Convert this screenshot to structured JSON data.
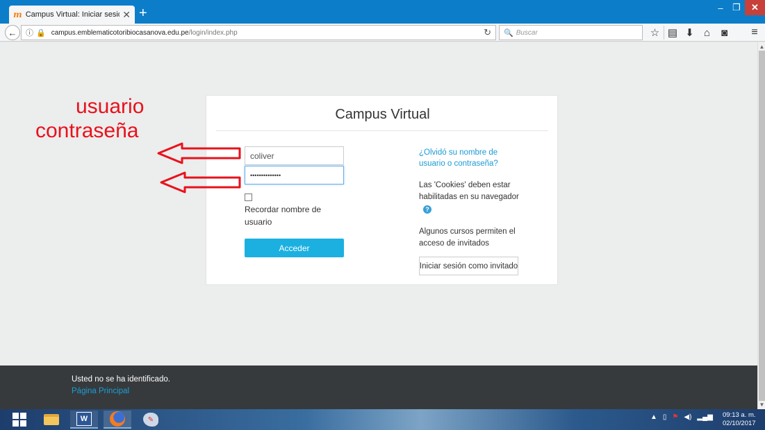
{
  "browser": {
    "tab_title": "Campus Virtual: Iniciar sesión",
    "tab_favicon": "m",
    "new_tab": "+",
    "tab_close": "✕",
    "url_host": "campus.emblematicotoribiocasanova.edu.pe",
    "url_path": "/login/index.php",
    "search_placeholder": "Buscar",
    "window_controls": {
      "minimize": "–",
      "maximize": "❐",
      "close": "✕"
    }
  },
  "login": {
    "title": "Campus Virtual",
    "username_value": "coliver",
    "password_value": "••••••••••••••",
    "remember_label": "Recordar nombre de usuario",
    "submit_label": "Acceder",
    "forgot_link": "¿Olvidó su nombre de usuario o contraseña?",
    "cookies_text": "Las 'Cookies' deben estar habilitadas en su navegador",
    "guest_text": "Algunos cursos permiten el acceso de invitados",
    "guest_button": "Iniciar sesión como invitado"
  },
  "annotations": {
    "username_label": "usuario",
    "password_label": "contraseña",
    "color": "#e8121b"
  },
  "footer": {
    "status_text": "Usted no se ha identificado.",
    "home_link": "Página Principal"
  },
  "taskbar": {
    "apps": [
      "start-icon",
      "file-explorer-icon",
      "word-icon",
      "firefox-icon",
      "paint-icon"
    ],
    "time": "09:13 a. m.",
    "date": "02/10/2017"
  },
  "colors": {
    "accent": "#1cb0e1",
    "link": "#1b9ad6",
    "footer_bg": "#373a3c",
    "titlebar": "#0c7ec9"
  }
}
